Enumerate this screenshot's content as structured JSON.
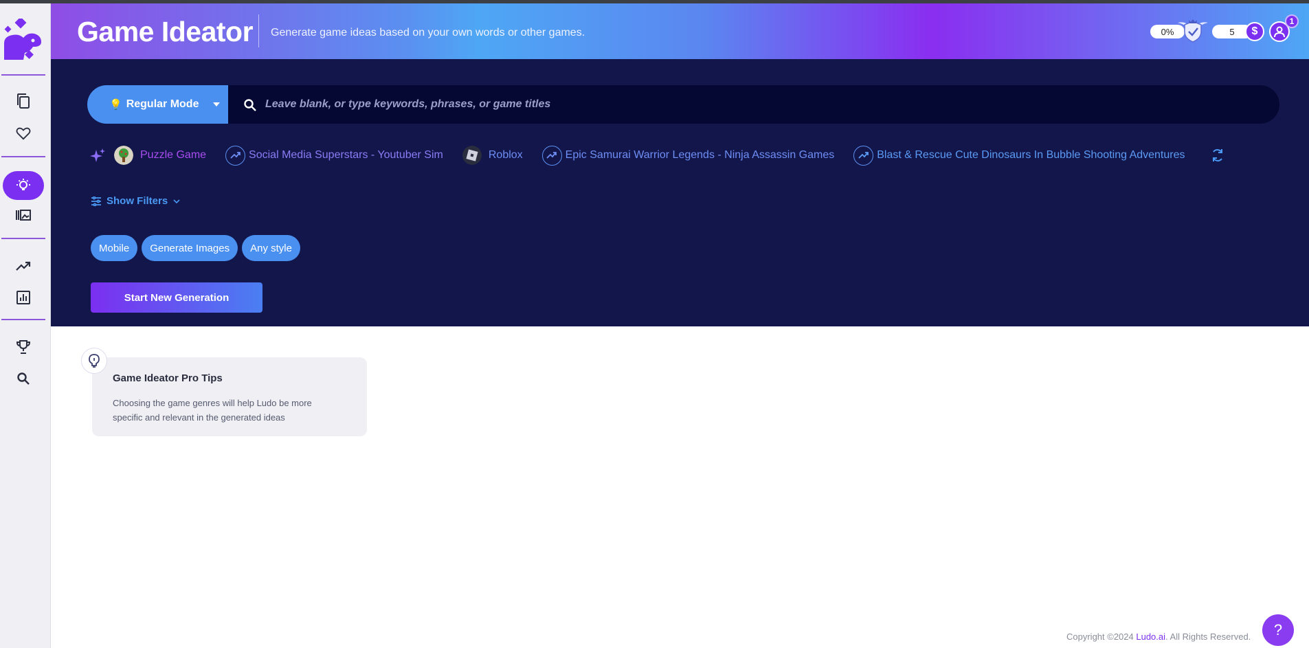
{
  "header": {
    "title": "Game Ideator",
    "subtitle": "Generate game ideas based on your own words or other games.",
    "progress_label": "0%",
    "credits": "5",
    "notification_count": "1"
  },
  "search": {
    "mode_label": "Regular Mode",
    "placeholder": "Leave blank, or type keywords, phrases, or game titles"
  },
  "suggestions": [
    {
      "label": "Puzzle Game",
      "color": "#a84df0",
      "kind": "image"
    },
    {
      "label": "Social Media Superstars - Youtuber Sim",
      "color": "#8b7cf6",
      "kind": "trend"
    },
    {
      "label": "Roblox",
      "color": "#6e8ef5",
      "kind": "image"
    },
    {
      "label": "Epic Samurai Warrior Legends - Ninja Assassin Games",
      "color": "#6e8ef5",
      "kind": "trend"
    },
    {
      "label": "Blast & Rescue Cute Dinosaurs In Bubble Shooting Adventures",
      "color": "#5b9af5",
      "kind": "trend"
    }
  ],
  "filters": {
    "toggle_label": "Show Filters",
    "chips": [
      "Mobile",
      "Generate Images",
      "Any style"
    ]
  },
  "actions": {
    "start_label": "Start New Generation"
  },
  "tip": {
    "title": "Game Ideator Pro Tips",
    "text": "Choosing the game genres will help Ludo be more specific and relevant in the generated ideas"
  },
  "footer": {
    "copyright_prefix": "Copyright ©2024 ",
    "brand": "Ludo.ai",
    "suffix": ". All Rights Reserved."
  },
  "help": {
    "label": "?"
  },
  "colors": {
    "accent": "#7b2ff0",
    "blue": "#4a90f0",
    "panel": "#13164a"
  }
}
